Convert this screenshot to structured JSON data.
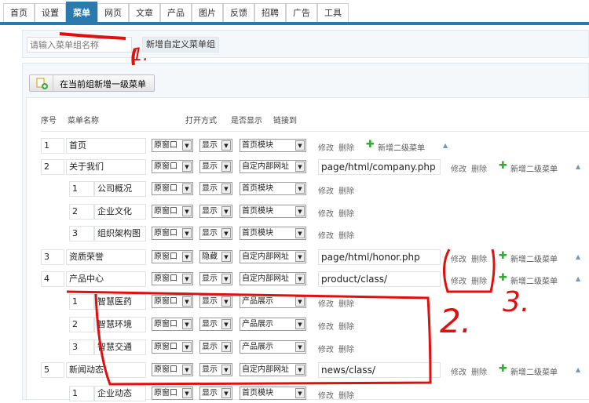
{
  "tabs": [
    "首页",
    "设置",
    "菜单",
    "网页",
    "文章",
    "产品",
    "图片",
    "反馈",
    "招聘",
    "广告",
    "工具"
  ],
  "active_tab": "菜单",
  "group": {
    "placeholder": "请输入菜单组名称",
    "add_button": "新增自定义菜单组"
  },
  "add_top_button": "在当前组新增一级菜单",
  "headers": {
    "seq": "序号",
    "name": "菜单名称",
    "open": "打开方式",
    "show": "是否显示",
    "link": "链接到"
  },
  "actions": {
    "edit": "修改",
    "delete": "删除",
    "add_sub": "新增二级菜单"
  },
  "rows": [
    {
      "level": 1,
      "seq": "1",
      "name": "首页",
      "open": "原窗口",
      "show": "显示",
      "link": "首页模块",
      "url": null
    },
    {
      "level": 1,
      "seq": "2",
      "name": "关于我们",
      "open": "原窗口",
      "show": "显示",
      "link": "自定内部网址",
      "url": "page/html/company.php"
    },
    {
      "level": 2,
      "seq": "1",
      "name": "公司概况",
      "open": "原窗口",
      "show": "显示",
      "link": "首页模块"
    },
    {
      "level": 2,
      "seq": "2",
      "name": "企业文化",
      "open": "原窗口",
      "show": "显示",
      "link": "首页模块"
    },
    {
      "level": 2,
      "seq": "3",
      "name": "组织架构图",
      "open": "原窗口",
      "show": "显示",
      "link": "首页模块"
    },
    {
      "level": 1,
      "seq": "3",
      "name": "资质荣誉",
      "open": "原窗口",
      "show": "隐藏",
      "link": "自定内部网址",
      "url": "page/html/honor.php"
    },
    {
      "level": 1,
      "seq": "4",
      "name": "产品中心",
      "open": "原窗口",
      "show": "显示",
      "link": "自定内部网址",
      "url": "product/class/"
    },
    {
      "level": 2,
      "seq": "1",
      "name": "智慧医药",
      "open": "原窗口",
      "show": "显示",
      "link": "产品展示"
    },
    {
      "level": 2,
      "seq": "2",
      "name": "智慧环境",
      "open": "原窗口",
      "show": "显示",
      "link": "产品展示"
    },
    {
      "level": 2,
      "seq": "3",
      "name": "智慧交通",
      "open": "原窗口",
      "show": "显示",
      "link": "产品展示"
    },
    {
      "level": 1,
      "seq": "5",
      "name": "新闻动态",
      "open": "原窗口",
      "show": "显示",
      "link": "自定内部网址",
      "url": "news/class/"
    },
    {
      "level": 2,
      "seq": "1",
      "name": "企业动态",
      "open": "原窗口",
      "show": "显示",
      "link": "首页模块"
    }
  ],
  "annotations": [
    "1.",
    "2.",
    "3."
  ],
  "colors": {
    "accent": "#2a7ab0",
    "annotation": "#e01010"
  }
}
